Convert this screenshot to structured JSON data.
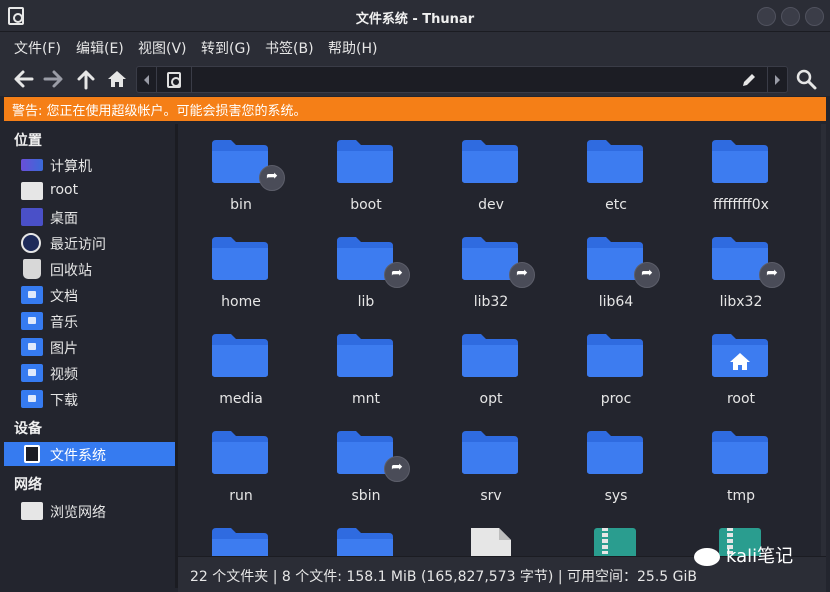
{
  "window": {
    "title": "文件系统 - Thunar"
  },
  "menu": [
    "文件(F)",
    "编辑(E)",
    "视图(V)",
    "转到(G)",
    "书签(B)",
    "帮助(H)"
  ],
  "toolbar": {
    "back_icon": "arrow-left-icon",
    "forward_icon": "arrow-right-icon",
    "up_icon": "arrow-up-icon",
    "home_icon": "home-icon",
    "search_icon": "search-icon",
    "path_value": ""
  },
  "warning": {
    "text": "警告: 您正在使用超级帐户。可能会损害您的系统。",
    "color": "#f57f17"
  },
  "sidebar": {
    "sections": [
      {
        "title": "位置",
        "items": [
          {
            "label": "计算机",
            "icon": "computer-icon"
          },
          {
            "label": "root",
            "icon": "home-folder-icon"
          },
          {
            "label": "桌面",
            "icon": "desktop-icon"
          },
          {
            "label": "最近访问",
            "icon": "recent-icon"
          },
          {
            "label": "回收站",
            "icon": "trash-icon"
          },
          {
            "label": "文档",
            "icon": "documents-folder-icon"
          },
          {
            "label": "音乐",
            "icon": "music-folder-icon"
          },
          {
            "label": "图片",
            "icon": "pictures-folder-icon"
          },
          {
            "label": "视频",
            "icon": "videos-folder-icon"
          },
          {
            "label": "下载",
            "icon": "downloads-folder-icon"
          }
        ]
      },
      {
        "title": "设备",
        "items": [
          {
            "label": "文件系统",
            "icon": "drive-icon",
            "selected": true
          }
        ]
      },
      {
        "title": "网络",
        "items": [
          {
            "label": "浏览网络",
            "icon": "network-icon"
          }
        ]
      }
    ]
  },
  "files": [
    {
      "name": "bin",
      "type": "folder",
      "symlink": true
    },
    {
      "name": "boot",
      "type": "folder",
      "symlink": false
    },
    {
      "name": "dev",
      "type": "folder",
      "symlink": false
    },
    {
      "name": "etc",
      "type": "folder",
      "symlink": false
    },
    {
      "name": "ffffffff0x",
      "type": "folder",
      "symlink": false
    },
    {
      "name": "home",
      "type": "folder",
      "symlink": false
    },
    {
      "name": "lib",
      "type": "folder",
      "symlink": true
    },
    {
      "name": "lib32",
      "type": "folder",
      "symlink": true
    },
    {
      "name": "lib64",
      "type": "folder",
      "symlink": true
    },
    {
      "name": "libx32",
      "type": "folder",
      "symlink": true
    },
    {
      "name": "media",
      "type": "folder",
      "symlink": false
    },
    {
      "name": "mnt",
      "type": "folder",
      "symlink": false
    },
    {
      "name": "opt",
      "type": "folder",
      "symlink": false
    },
    {
      "name": "proc",
      "type": "folder",
      "symlink": false
    },
    {
      "name": "root",
      "type": "home-folder",
      "symlink": false
    },
    {
      "name": "run",
      "type": "folder",
      "symlink": false
    },
    {
      "name": "sbin",
      "type": "folder",
      "symlink": true
    },
    {
      "name": "srv",
      "type": "folder",
      "symlink": false
    },
    {
      "name": "sys",
      "type": "folder",
      "symlink": false
    },
    {
      "name": "tmp",
      "type": "folder",
      "symlink": false
    },
    {
      "name": "",
      "type": "folder",
      "symlink": false
    },
    {
      "name": "",
      "type": "folder",
      "symlink": false
    },
    {
      "name": "",
      "type": "file",
      "symlink": false
    },
    {
      "name": "",
      "type": "archive",
      "symlink": false
    },
    {
      "name": "",
      "type": "archive",
      "symlink": false
    }
  ],
  "status": {
    "text": "22 个文件夹 | 8 个文件: 158.1 MiB (165,827,573 字节) | 可用空间：25.5 GiB"
  },
  "watermark": {
    "text": "kali笔记"
  },
  "colors": {
    "accent": "#367bf0",
    "background": "#23252e",
    "chrome": "#2b2d36"
  }
}
